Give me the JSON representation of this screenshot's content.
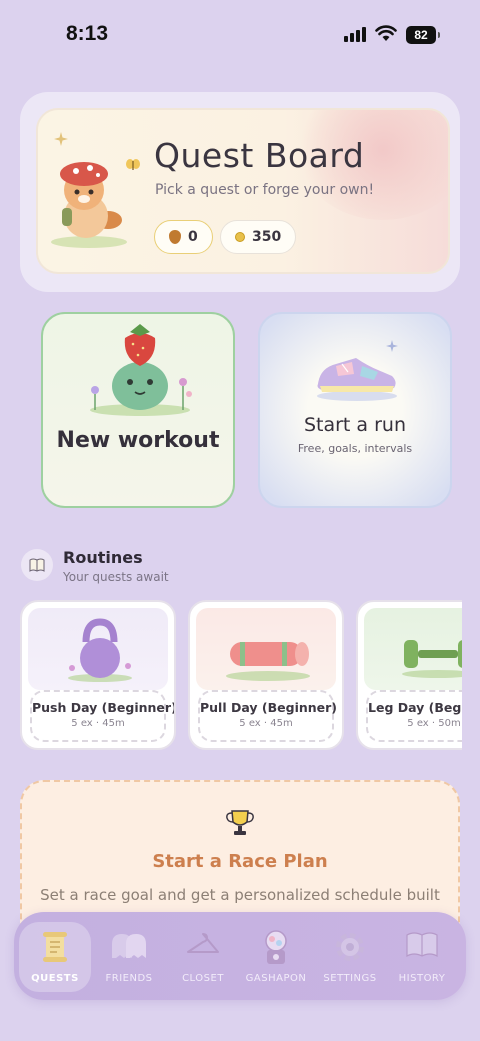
{
  "status": {
    "time": "8:13",
    "battery": "82"
  },
  "board": {
    "title": "Quest Board",
    "subtitle": "Pick a quest or forge your own!",
    "drops": "0",
    "coins": "350"
  },
  "actions": {
    "workout": {
      "title": "New workout"
    },
    "run": {
      "title": "Start a run",
      "subtitle": "Free, goals, intervals"
    }
  },
  "routines": {
    "title": "Routines",
    "subtitle": "Your quests await",
    "items": [
      {
        "name": "Push Day (Beginner)",
        "meta": "5 ex · 45m",
        "icon": "kettlebell-icon"
      },
      {
        "name": "Pull Day (Beginner)",
        "meta": "5 ex · 45m",
        "icon": "yoga-mat-icon"
      },
      {
        "name": "Leg Day (Beginner)",
        "meta": "5 ex · 50m",
        "icon": "dumbbell-icon"
      }
    ]
  },
  "race": {
    "title": "Start a Race Plan",
    "description": "Set a race goal and get a personalized schedule built"
  },
  "nav": {
    "items": [
      {
        "label": "QUESTS",
        "icon": "scroll-icon",
        "active": true
      },
      {
        "label": "FRIENDS",
        "icon": "ghosts-icon",
        "active": false
      },
      {
        "label": "CLOSET",
        "icon": "hanger-icon",
        "active": false
      },
      {
        "label": "GASHAPON",
        "icon": "capsule-machine-icon",
        "active": false
      },
      {
        "label": "SETTINGS",
        "icon": "gear-icon",
        "active": false
      },
      {
        "label": "HISTORY",
        "icon": "book-icon",
        "active": false
      }
    ]
  },
  "colors": {
    "background": "#dcd2ee",
    "race_title": "#cd7f4e",
    "workout_border": "#9ed0a0",
    "nav": "#c6b2e1"
  }
}
